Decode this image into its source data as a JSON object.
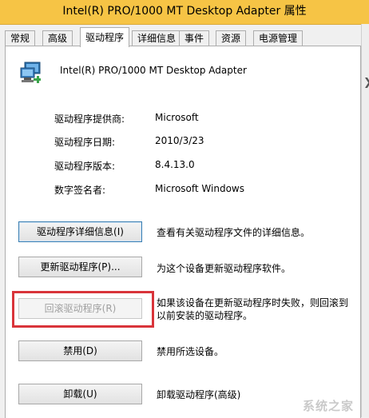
{
  "window": {
    "title": "Intel(R) PRO/1000 MT Desktop Adapter 属性"
  },
  "tabs": [
    {
      "label": "常规"
    },
    {
      "label": "高级"
    },
    {
      "label": "驱动程序"
    },
    {
      "label": "详细信息"
    },
    {
      "label": "事件"
    },
    {
      "label": "资源"
    },
    {
      "label": "电源管理"
    }
  ],
  "device": {
    "name": "Intel(R) PRO/1000 MT Desktop Adapter",
    "icon": "network-adapter-icon"
  },
  "driver_info": [
    {
      "label": "驱动程序提供商:",
      "value": "Microsoft"
    },
    {
      "label": "驱动程序日期:",
      "value": "2010/3/23"
    },
    {
      "label": "驱动程序版本:",
      "value": "8.4.13.0"
    },
    {
      "label": "数字签名者:",
      "value": "Microsoft Windows"
    }
  ],
  "actions": [
    {
      "button": "驱动程序详细信息(I)",
      "description": "查看有关驱动程序文件的详细信息。"
    },
    {
      "button": "更新驱动程序(P)...",
      "description": "为这个设备更新驱动程序软件。"
    },
    {
      "button": "回滚驱动程序(R)",
      "description_line1": "如果该设备在更新驱动程序时失败，则回滚到",
      "description_line2": "以前安装的驱动程序。"
    },
    {
      "button": "禁用(D)",
      "description": "禁用所选设备。"
    },
    {
      "button": "卸载(U)",
      "description": "卸载驱动程序(高级)"
    }
  ],
  "colors": {
    "titlebar": "#f6c445",
    "highlight": "#d9343a"
  },
  "watermark": "系统之家"
}
